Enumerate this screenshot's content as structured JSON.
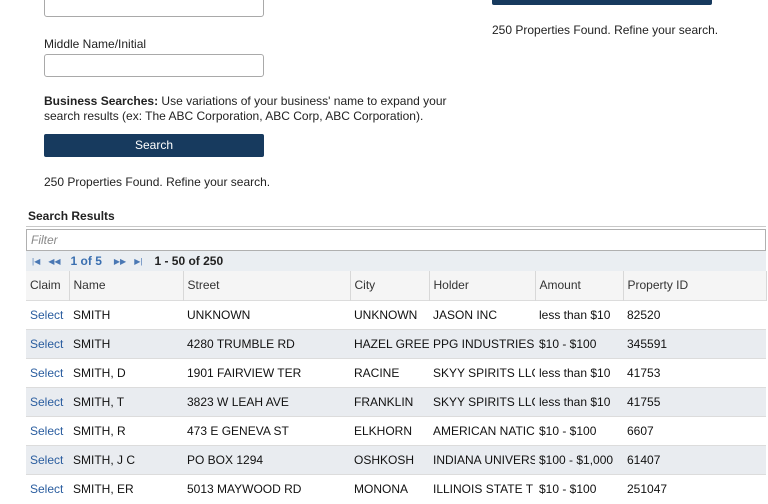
{
  "form": {
    "middle_label": "Middle Name/Initial",
    "business_bold": "Business Searches:",
    "business_text": " Use variations of your business' name to expand your search results (ex: The ABC Corporation, ABC Corp, ABC Corporation).",
    "search_label": "Search",
    "found_text": "250 Properties Found. Refine your search."
  },
  "right_panel": {
    "found_text": "250 Properties Found. Refine your search."
  },
  "results": {
    "title": "Search Results",
    "filter_placeholder": "Filter",
    "pager": {
      "pages": "1 of 5",
      "range": "1 - 50 of 250"
    },
    "columns": [
      "Claim",
      "Name",
      "Street",
      "City",
      "Holder",
      "Amount",
      "Property ID"
    ],
    "rows": [
      [
        "Select",
        "SMITH",
        "UNKNOWN",
        "UNKNOWN",
        "JASON INC",
        "less than $10",
        "82520"
      ],
      [
        "Select",
        "SMITH",
        "4280 TRUMBLE RD",
        "HAZEL GREE",
        "PPG INDUSTRIES",
        "$10 - $100",
        "345591"
      ],
      [
        "Select",
        "SMITH, D",
        "1901 FAIRVIEW TER",
        "RACINE",
        "SKYY SPIRITS LLC",
        "less than $10",
        "41753"
      ],
      [
        "Select",
        "SMITH, T",
        "3823 W LEAH AVE",
        "FRANKLIN",
        "SKYY SPIRITS LLC",
        "less than $10",
        "41755"
      ],
      [
        "Select",
        "SMITH, R",
        "473 E GENEVA ST",
        "ELKHORN",
        "AMERICAN NATIC",
        "$10 - $100",
        "6607"
      ],
      [
        "Select",
        "SMITH, J C",
        "PO BOX 1294",
        "OSHKOSH",
        "INDIANA UNIVERS",
        "$100 - $1,000",
        "61407"
      ],
      [
        "Select",
        "SMITH, ER",
        "5013 MAYWOOD RD",
        "MONONA",
        "ILLINOIS STATE T",
        "$10 - $100",
        "251047"
      ]
    ]
  }
}
